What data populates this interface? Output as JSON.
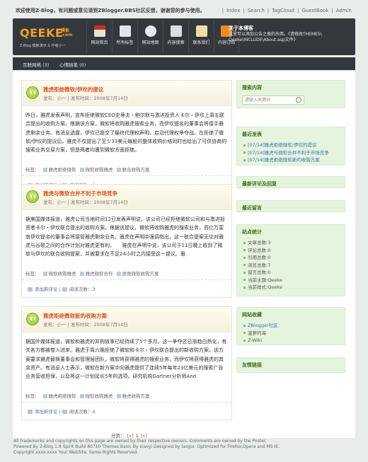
{
  "top": {
    "welcome": "欢迎使用Z-Blog，有问题或意见请到ZBlogger.BBS社区反馈，谢谢您的参与使用。",
    "links": [
      "Index",
      "Search",
      "TagCloud",
      "GuestBook",
      "Admin"
    ]
  },
  "header": {
    "logo_text": "QEEKE",
    "logo_cn": "模板",
    "logo_com": ".com",
    "logo_sub": "Z-Blog 模板演示 & 作者小一",
    "nav": [
      {
        "label": "网站首页",
        "icon": "home-icon",
        "color": "#e7e2d8"
      },
      {
        "label": "所有标签",
        "icon": "tags-icon",
        "color": "#dfe3ea"
      },
      {
        "label": "网站地图",
        "icon": "sitemap-icon",
        "color": "#e6eaf3"
      },
      {
        "label": "内容搜索",
        "icon": "search-icon",
        "color": "#dcdde0"
      },
      {
        "label": "联系我们",
        "icon": "contact-icon",
        "color": "#ecdfa6"
      },
      {
        "label": "内容订阅",
        "icon": "rss-icon",
        "color": "#ef8b27"
      }
    ],
    "about_title": "关于本博客",
    "about_lines": [
      "这里可以添加公告之类的东西。《请修改THEMES\\",
      "Qeeke\\INCLUDE\\About.asp文件》"
    ]
  },
  "catbar": {
    "items": [
      "互联网络 (3)",
      "心情随笔 (0)"
    ]
  },
  "posts": [
    {
      "title": "雅虎拒绝微软/伊坎的提议",
      "meta": "发布：小一 | 发布时间：2008年7月14日",
      "body": "昨日，雅虎发表声明，宣布拒绝微软CEO史蒂夫・鲍尔默与激进投资人卡尔・伊坎上周五联合提出的收购方案。根据该方案，微软将收购雅虎搜索业务，而伊坎提名的董事会将接手雅虎剩余业务。有消息透露，伊坎已提交了最终代理权声明，启动代理权争夺战。在拒绝了微软/伊坎的提议后，雅虎不仅提出了至少33美元每股的整体收购价格同时也给出了可供协商的搜索业务交易方案，但是两者均遭到微软方面拒绝。",
      "tags_label": "标签：",
      "tags": [
        "雅虎拒绝微软",
        "微软收购雅虎",
        "联合收购方案"
      ],
      "comment_link": "添加新评论",
      "reads": "阅读次数：1"
    },
    {
      "title": "雅虎与微软合并不利于市场竞争",
      "meta": "发布：小一 | 发布时间：2008年7月14日",
      "body": "据美国媒体报道，雅虎公司当地时间12日发表声明说，该公司已经拒绝微软公司和与激进投资者卡尔・伊坎联合提出的收购方案。根据该提议，微软将收购雅虎的搜索业务，而亿万富翁伊坎提名的董事会将接管雅虎剩余业务。雅虎在声明中强调指出，这一联合提案无论对雅虎与谷歌之间的合作计划对雅虎更有利。　　雅虎在声明中说，该公司于11日晚上收到了微软与伊坎的联合收购提案，并被要求在不足24小时之内接受这一提议。雅",
      "tags_label": "标签：",
      "tags": [
        "微软收购雅虎",
        "雅虎微软合作",
        "拒绝微软收购方案"
      ],
      "comment_link": "添加新评论",
      "reads": "阅读次数：3"
    },
    {
      "title": "雅虎拒绝微软新的收购方案",
      "meta": "发布：小一 | 发布时间：2008年7月14日",
      "body": "据国外媒体报道，微软和雅虎的并购故事已经持续了5个多月。这一争夺还日渐趋白热化，有关各方都被卷入进来。雅虎于周六晚拒绝了微软和卡尔・伊坎联合提出的新收购方案。该方案要求雅虎替换董事会和管理层团队，微软将获得雅虎的搜索业务，而伊坎将获得雅虎的其余资产。有消息人士表示，微软在新方案中向雅虎提供了连续5年每年23亿美元的搜索广告业务营收担保，以及将这一计划延长5年的选项。研究机构Gartner分析师And",
      "tags_label": "标签：",
      "tags": [
        "雅虎拒绝微软",
        "微软收购雅虎",
        "雅虎收购方案"
      ],
      "comment_link": "添加新评论",
      "reads": "阅读次数：4"
    }
  ],
  "pager": {
    "label": "分页：",
    "first": "[«]",
    "current": "1",
    "last": "[»]"
  },
  "sidebar": {
    "search_title": "搜索内容",
    "search_placeholder": "请输入关键词",
    "recent_title": "最近发表",
    "recent": [
      "[07/14]雅虎拒绝微软/伊坎的提议",
      "[07/14]雅虎与微软合并不利于市场竞争",
      "[07/14]雅虎拒绝微软新的收购方案"
    ],
    "comments_title": "最新评论及回复",
    "guestbook_title": "最近留言",
    "stats_title": "站点统计",
    "stats": [
      "文章总数:3",
      "评论总数:0",
      "引用总数:0",
      "浏览总数:7",
      "留言总数:0",
      "当前主题:Qeeke",
      "当前样式:Qeeke"
    ],
    "favs_title": "网站收藏",
    "favs": [
      "ZBlogger社区",
      "菠萝的海",
      "Z-Wiki"
    ],
    "links_title": "友情链接"
  },
  "footer": {
    "lines": [
      "All trademarks and copyrights on this page are owned by their respective owners. Comments are owned by the Poster.",
      "Powered By Z-Blog 1.8 Spirit Build 80710   Themes Basic By xiaoyi   Designed by laogui. Optimized for Firefox,Opera and MS-IE.",
      "Copyright xxxx-xxxx Your WebSite. Some Rights Reserved."
    ]
  }
}
